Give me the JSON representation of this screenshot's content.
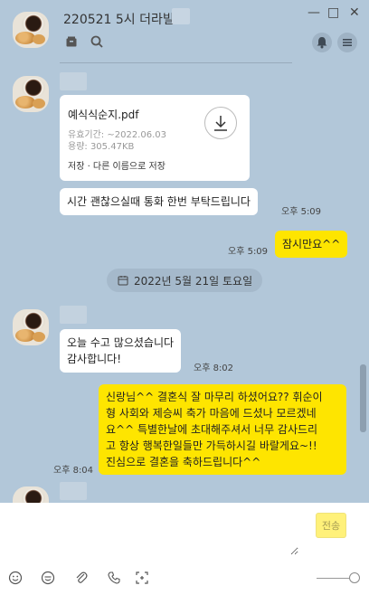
{
  "header": {
    "title": "220521 5시 더라빌",
    "window_controls": {
      "minimize": "—",
      "maximize": "□",
      "close": "✕"
    }
  },
  "messages": {
    "file": {
      "name": "예식식순지.pdf",
      "expiry": "유효기간: ~2022.06.03",
      "size": "용량: 305.47KB",
      "actions": "저장 · 다른 이름으로 저장"
    },
    "msg1": {
      "text": "시간 괜찮으실때 통화 한번 부탁드립니다",
      "time": "오후 5:09"
    },
    "msg2": {
      "text": "잠시만요^^",
      "time": "오후 5:09"
    },
    "date_divider": "2022년 5월 21일 토요일",
    "msg3": {
      "line1": "오늘 수고 많으셨습니다",
      "line2": "감사합니다!",
      "time": "오후 8:02"
    },
    "msg4": {
      "lines": [
        "신랑님^^ 결혼식 잘 마무리 하셨어요?? 휘순이",
        "형 사회와 제승씨 축가 마음에 드셨나 모르겠네",
        "요^^ 특별한날에 초대해주셔서 너무 감사드리",
        "고 항상 행복한일들만 가득하시길 바랄게요~!!",
        "진심으로 결혼을 축하드립니다^^"
      ],
      "time": "오후 8:04"
    }
  },
  "input": {
    "placeholder": "",
    "send_label": "전송"
  },
  "icons": {
    "header": [
      "box-icon",
      "search-icon",
      "bell-icon",
      "menu-icon"
    ],
    "toolbar": [
      "emoji-icon",
      "emoticon-icon",
      "attach-icon",
      "phone-icon",
      "capture-icon"
    ]
  },
  "colors": {
    "chat_bg": "#b2c7d9",
    "my_bubble": "#fee500",
    "other_bubble": "#ffffff"
  }
}
